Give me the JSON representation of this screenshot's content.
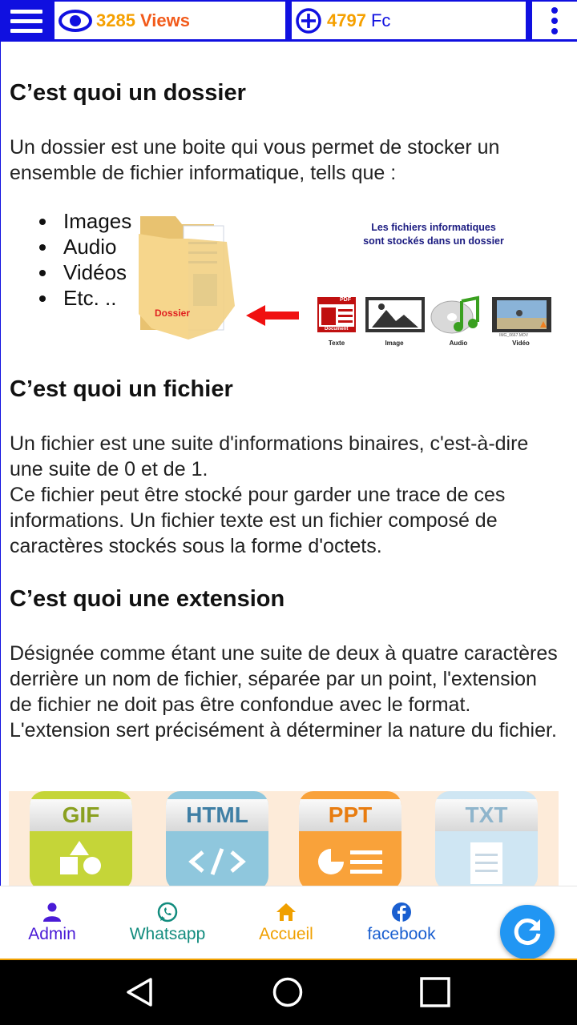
{
  "topbar": {
    "views_count": "3285",
    "views_label": "Views",
    "fc_count": "4797",
    "fc_label": "Fc"
  },
  "sections": {
    "dossier_title": "C’est quoi un dossier",
    "dossier_text": "Un dossier est une boite qui vous permet de stocker un ensemble de fichier informatique, tells que :",
    "bullets": [
      "Images",
      "Audio",
      "Vidéos",
      "Etc. .."
    ],
    "fichier_title": "C’est quoi un fichier",
    "fichier_text_1": "Un fichier est une suite d'informations binaires, c'est-à-dire une suite de 0 et de 1.",
    "fichier_text_2": "Ce fichier peut être stocké pour garder une trace de ces informations. Un fichier texte est un fichier composé de caractères stockés sous la forme d'octets.",
    "extension_title": "C’est quoi une extension",
    "extension_text": "Désignée comme étant une suite de deux à quatre caractères derrière un nom de fichier, séparée par un point, l'extension de fichier ne doit pas être confondue avec le format. L'extension sert précisément à déterminer la nature du fichier."
  },
  "illustration": {
    "folder_label": "Dossier",
    "caption_line1": "Les fichiers informatiques",
    "caption_line2": "sont stockés dans un dossier",
    "pdf_top": "PDF",
    "pdf_bottom": "Document",
    "labels": [
      "Texte",
      "Image",
      "Audio",
      "Vidéo"
    ],
    "video_filename": "IMG_0667.MOV"
  },
  "extensions": [
    {
      "label": "GIF",
      "color": "#c5d538",
      "text_color": "#8aa020"
    },
    {
      "label": "HTML",
      "color": "#8fc7dd",
      "text_color": "#3f7fa5"
    },
    {
      "label": "PPT",
      "color": "#f9a23a",
      "text_color": "#e87c10"
    },
    {
      "label": "TXT",
      "color": "#cfe6f3",
      "text_color": "#8fb5cc"
    }
  ],
  "bottom_nav": {
    "admin": "Admin",
    "whatsapp": "Whatsapp",
    "accueil": "Accueil",
    "facebook": "facebook"
  },
  "colors": {
    "brand_blue": "#1010e0",
    "accent_orange": "#f5a000",
    "fab_blue": "#2196f3"
  }
}
